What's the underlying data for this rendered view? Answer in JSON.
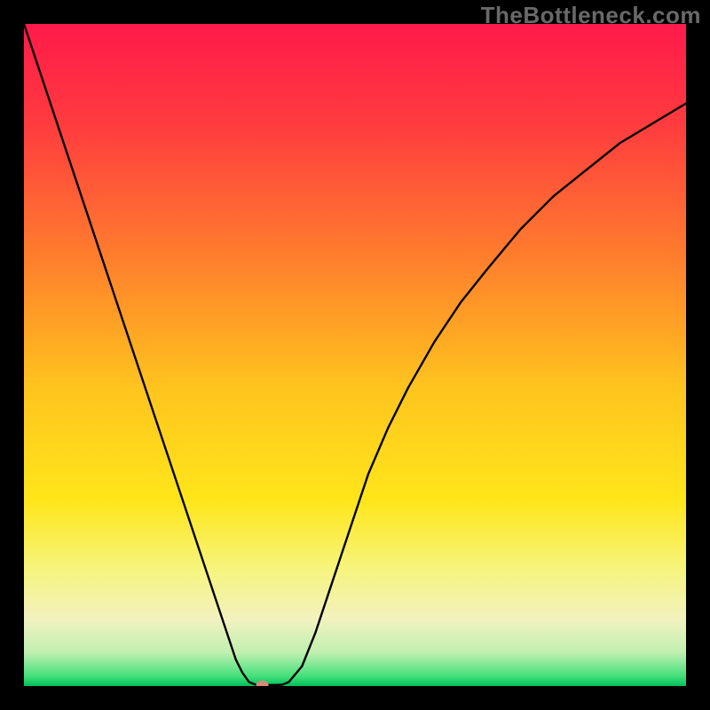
{
  "watermark": "TheBottleneck.com",
  "chart_data": {
    "type": "line",
    "title": "",
    "xlabel": "",
    "ylabel": "",
    "xlim": [
      0,
      100
    ],
    "ylim": [
      0,
      100
    ],
    "background_gradient": {
      "stops": [
        {
          "offset": 0.0,
          "color": "#ff1a4a"
        },
        {
          "offset": 0.15,
          "color": "#ff3b3f"
        },
        {
          "offset": 0.35,
          "color": "#ff7d2d"
        },
        {
          "offset": 0.55,
          "color": "#ffc41e"
        },
        {
          "offset": 0.72,
          "color": "#ffe61a"
        },
        {
          "offset": 0.82,
          "color": "#f6f47a"
        },
        {
          "offset": 0.9,
          "color": "#f2f2c0"
        },
        {
          "offset": 0.95,
          "color": "#bff0b0"
        },
        {
          "offset": 0.985,
          "color": "#44e07a"
        },
        {
          "offset": 1.0,
          "color": "#00c05a"
        }
      ]
    },
    "series": [
      {
        "name": "bottleneck-curve",
        "color": "#000000",
        "stroke_width": 2.4,
        "x": [
          0,
          2,
          4,
          6,
          8,
          10,
          12,
          14,
          16,
          18,
          20,
          22,
          24,
          26,
          28,
          30,
          31,
          32,
          33,
          34,
          35,
          36,
          37,
          38,
          39,
          40,
          42,
          44,
          46,
          48,
          50,
          52,
          55,
          58,
          62,
          66,
          70,
          75,
          80,
          85,
          90,
          95,
          100
        ],
        "y": [
          100,
          94,
          88,
          82,
          76,
          70,
          64,
          58,
          52,
          46,
          40,
          34,
          28,
          22,
          16,
          10,
          7,
          4,
          2,
          0.6,
          0.2,
          0.2,
          0.15,
          0.15,
          0.2,
          0.6,
          3,
          8,
          14,
          20,
          26,
          32,
          39,
          45,
          52,
          58,
          63,
          69,
          74,
          78,
          82,
          85,
          88
        ]
      }
    ],
    "marker": {
      "name": "optimum-point",
      "x": 36,
      "y": 0.15,
      "color": "#d88a7a",
      "rx": 7,
      "ry": 5
    }
  }
}
